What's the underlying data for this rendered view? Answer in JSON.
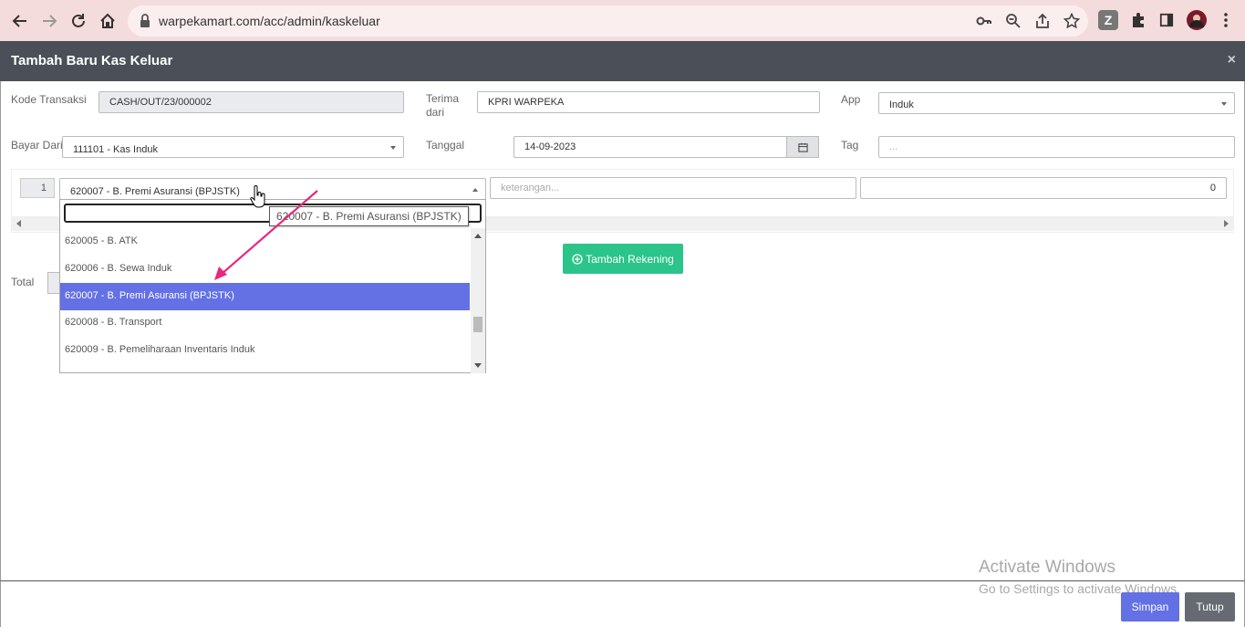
{
  "browser": {
    "url": "warpekamart.com/acc/admin/kaskeluar"
  },
  "modal": {
    "title": "Tambah Baru Kas Keluar",
    "close_glyph": "×"
  },
  "form": {
    "kode_transaksi_label": "Kode Transaksi",
    "kode_transaksi_value": "CASH/OUT/23/000002",
    "terima_dari_label_1": "Terima",
    "terima_dari_label_2": "dari",
    "terima_dari_value": "KPRI WARPEKA",
    "app_label": "App",
    "app_value": "Induk",
    "bayar_dari_label": "Bayar Dari",
    "bayar_dari_value": "111101 - Kas Induk",
    "tanggal_label": "Tanggal",
    "tanggal_value": "14-09-2023",
    "tag_label": "Tag",
    "tag_placeholder": "...",
    "total_label": "Total"
  },
  "detail_row": {
    "number": "1",
    "account_value": "620007 - B. Premi Asuransi (BPJSTK)",
    "keterangan_placeholder": "keterangan...",
    "amount_value": "0"
  },
  "dropdown": {
    "tooltip": "620007 - B. Premi Asuransi (BPJSTK)",
    "items": [
      "620005 - B. ATK",
      "620006 - B. Sewa Induk",
      "620007 - B. Premi Asuransi (BPJSTK)",
      "620008 - B. Transport",
      "620009 - B. Pemeliharaan Inventaris Induk"
    ],
    "selected_index": 2
  },
  "buttons": {
    "tambah_rekening": "Tambah Rekening",
    "simpan": "Simpan",
    "tutup": "Tutup"
  },
  "watermark": {
    "line1": "Activate Windows",
    "line2": "Go to Settings to activate Windows."
  },
  "colors": {
    "header_bg": "#4a4f58",
    "primary": "#6371e4",
    "success": "#2bc48a",
    "annotation_arrow": "#e8287c"
  }
}
